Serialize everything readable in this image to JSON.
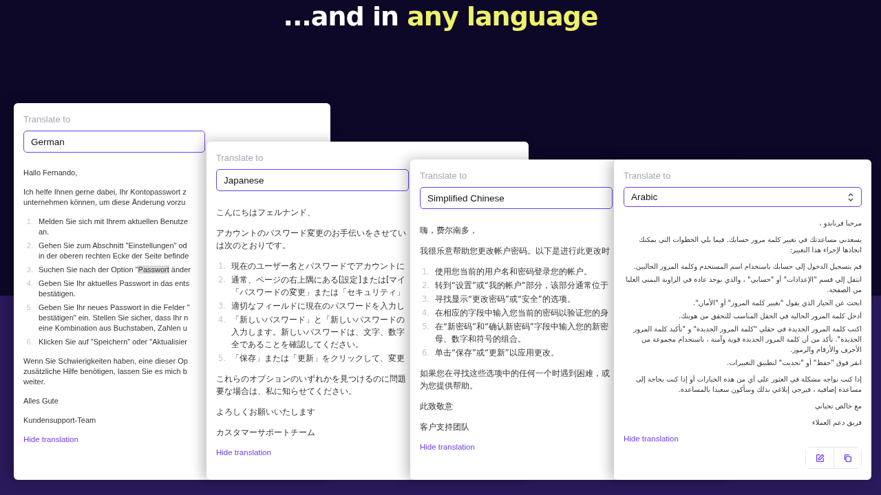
{
  "heading": {
    "text": "...and in ",
    "highlight": "any language"
  },
  "cards": [
    {
      "label": "Translate to",
      "language": "German",
      "kind": "latin",
      "body": [
        {
          "kind": "para",
          "lines": [
            "Hallo Fernando,"
          ]
        },
        {
          "kind": "para",
          "lines": [
            "Ich helfe Ihnen gerne dabei, Ihr Kontopasswort z",
            "unternehmen können, um diese Änderung vorzu"
          ]
        },
        {
          "kind": "steps",
          "items": [
            {
              "number": "1.",
              "lines": [
                "Melden Sie sich mit Ihrem aktuellen Benutze",
                "an."
              ]
            },
            {
              "number": "2.",
              "lines": [
                "Gehen Sie zum Abschnitt \"Einstellungen\" od",
                "in der oberen rechten Ecke der Seite befinde"
              ]
            },
            {
              "number": "3.",
              "lines": [
                {
                  "before": "Suchen Sie nach der Option \"",
                  "highlighted": "Passwort",
                  "after": " änder"
                }
              ]
            },
            {
              "number": "4.",
              "lines": [
                "Geben Sie Ihr aktuelles Passwort in das ents",
                "bestätigen."
              ]
            },
            {
              "number": "5.",
              "lines": [
                "Geben Sie Ihr neues Passwort in die Felder \"",
                "bestätigen\" ein. Stellen Sie sicher, dass Ihr n",
                "eine Kombination aus Buchstaben, Zahlen u"
              ]
            },
            {
              "number": "6.",
              "lines": [
                "Klicken Sie auf \"Speichern\" oder \"Aktualisier"
              ]
            }
          ]
        },
        {
          "kind": "para",
          "lines": [
            "Wenn Sie Schwierigkeiten haben, eine dieser Op",
            "zusätzliche Hilfe benötigen, lassen Sie es mich b",
            "weiter."
          ]
        },
        {
          "kind": "para",
          "lines": [
            "Alles Gute"
          ]
        },
        {
          "kind": "para",
          "lines": [
            "Kundensupport-Team"
          ]
        }
      ],
      "link": "Hide translation"
    },
    {
      "label": "Translate to",
      "language": "Japanese",
      "kind": "cjk",
      "body": [
        {
          "kind": "para",
          "lines": [
            "こんにちはフェルナンド、"
          ]
        },
        {
          "kind": "para",
          "lines": [
            "アカウントのパスワード変更のお手伝いをさせてい",
            "は次のとおりです。"
          ]
        },
        {
          "kind": "steps",
          "items": [
            {
              "number": "1.",
              "lines": [
                "現在のユーザー名とパスワードでアカウントに"
              ]
            },
            {
              "number": "2.",
              "lines": [
                "通常、ページの右上隅にある[設定]または[マイ",
                "「パスワードの変更」または「セキュリティ」"
              ]
            },
            {
              "number": "3.",
              "lines": [
                "適切なフィールドに現在のパスワードを入力し"
              ]
            },
            {
              "number": "4.",
              "lines": [
                "「新しいパスワード」と「新しいパスワードの",
                "入力します。新しいパスワードは、文字、数字",
                "全であることを確認してください。"
              ]
            },
            {
              "number": "5.",
              "lines": [
                "「保存」または「更新」をクリックして、変更"
              ]
            }
          ]
        },
        {
          "kind": "para",
          "lines": [
            "これらのオプションのいずれかを見つけるのに問題",
            "要な場合は、私に知らせてください。"
          ]
        },
        {
          "kind": "para",
          "lines": [
            "よろしくお願いいたします"
          ]
        },
        {
          "kind": "para",
          "lines": [
            "カスタマーサポートチーム"
          ]
        }
      ],
      "link": "Hide translation"
    },
    {
      "label": "Translate to",
      "language": "Simplified Chinese",
      "kind": "cjk",
      "body": [
        {
          "kind": "para",
          "lines": [
            "嗨，费尔南多，"
          ]
        },
        {
          "kind": "para",
          "lines": [
            "我很乐意帮助您更改帐户密码。以下是进行此更改时"
          ]
        },
        {
          "kind": "steps",
          "items": [
            {
              "number": "1.",
              "lines": [
                "使用您当前的用户名和密码登录您的帐户。"
              ]
            },
            {
              "number": "2.",
              "lines": [
                "转到“设置”或“我的帐户”部分，该部分通常位于"
              ]
            },
            {
              "number": "3.",
              "lines": [
                "寻找显示“更改密码”或“安全”的选项。"
              ]
            },
            {
              "number": "4.",
              "lines": [
                "在相应的字段中输入您当前的密码以验证您的身"
              ]
            },
            {
              "number": "5.",
              "lines": [
                "在“新密码”和“确认新密码”字段中输入您的新密",
                "母、数字和符号的组合。"
              ]
            },
            {
              "number": "6.",
              "lines": [
                "单击“保存”或“更新”以应用更改。"
              ]
            }
          ]
        },
        {
          "kind": "para",
          "lines": [
            "如果您在寻找这些选项中的任何一个时遇到困难，或",
            "为您提供帮助。"
          ]
        },
        {
          "kind": "para",
          "lines": [
            "此致敬意"
          ]
        },
        {
          "kind": "para",
          "lines": [
            "客户支持团队"
          ]
        }
      ],
      "link": "Hide translation"
    },
    {
      "label": "Translate to",
      "language": "Arabic",
      "kind": "rtl",
      "body": [
        {
          "kind": "para",
          "lines": [
            "مرحبا فرناندو ،"
          ]
        },
        {
          "kind": "para",
          "lines": [
            "يسعدني مساعدتك في تغيير كلمة مرور حسابك. فيما يلي الخطوات التي يمكنك اتخاذها لإجراء هذا التغيير:"
          ]
        },
        {
          "kind": "steps",
          "items": [
            {
              "lines": [
                "قم بتسجيل الدخول إلى حسابك باستخدام اسم المستخدم وكلمة المرور الحاليين."
              ]
            },
            {
              "lines": [
                "انتقل إلى قسم \"الإعدادات\" أو \"حسابي\" ، والذي يوجد عادة في الزاوية اليمنى العليا من الصفحة."
              ]
            },
            {
              "lines": [
                "ابحث عن الخيار الذي يقول \"تغيير كلمة المرور\" أو \"الأمان\"."
              ]
            },
            {
              "lines": [
                "أدخل كلمة المرور الحالية في الحقل المناسب للتحقق من هويتك."
              ]
            },
            {
              "lines": [
                "اكتب كلمة المرور الجديدة في حقلي \"كلمة المرور الجديدة\" و \"تأكيد كلمة المرور الجديدة\". تأكد من أن كلمة المرور الجديدة قوية وآمنة ، باستخدام مجموعة من الأحرف والأرقام والرموز."
              ]
            },
            {
              "lines": [
                "انقر فوق \"حفظ\" أو \"تحديث\" لتطبيق التغييرات."
              ]
            }
          ]
        },
        {
          "kind": "para",
          "lines": [
            "إذا كنت تواجه مشكلة في العثور على أي من هذه الخيارات أو إذا كنت بحاجة إلى مساعدة إضافية ، فيرجى إبلاغي بذلك وسأكون سعيدا بالمساعدة."
          ]
        },
        {
          "kind": "para",
          "lines": [
            "مع خالص تحياتي"
          ]
        },
        {
          "kind": "para",
          "lines": [
            "فريق دعم العملاء"
          ]
        }
      ],
      "link": "Hide translation",
      "actions": [
        {
          "kind": "edit"
        },
        {
          "kind": "copy"
        }
      ]
    }
  ]
}
